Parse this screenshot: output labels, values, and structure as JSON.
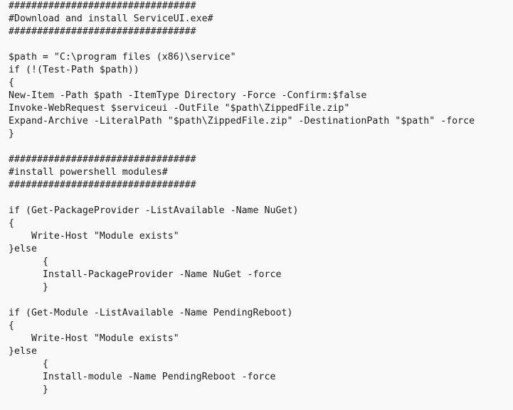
{
  "code": {
    "language": "powershell",
    "lines": [
      "#################################",
      "#Download and install ServiceUI.exe#",
      "#################################",
      "",
      "$path = \"C:\\program files (x86)\\service\"",
      "if (!(Test-Path $path))",
      "{",
      "New-Item -Path $path -ItemType Directory -Force -Confirm:$false",
      "Invoke-WebRequest $serviceui -OutFile \"$path\\ZippedFile.zip\"",
      "Expand-Archive -LiteralPath \"$path\\ZippedFile.zip\" -DestinationPath \"$path\" -force",
      "}",
      "",
      "#################################",
      "#install powershell modules#",
      "#################################",
      "",
      "if (Get-PackageProvider -ListAvailable -Name NuGet)",
      "{",
      "    Write-Host \"Module exists\"",
      "}else",
      "      {",
      "      Install-PackageProvider -Name NuGet -force",
      "      }",
      "",
      "if (Get-Module -ListAvailable -Name PendingReboot)",
      "{",
      "    Write-Host \"Module exists\"",
      "}else",
      "      {",
      "      Install-module -Name PendingReboot -force",
      "      }"
    ]
  }
}
